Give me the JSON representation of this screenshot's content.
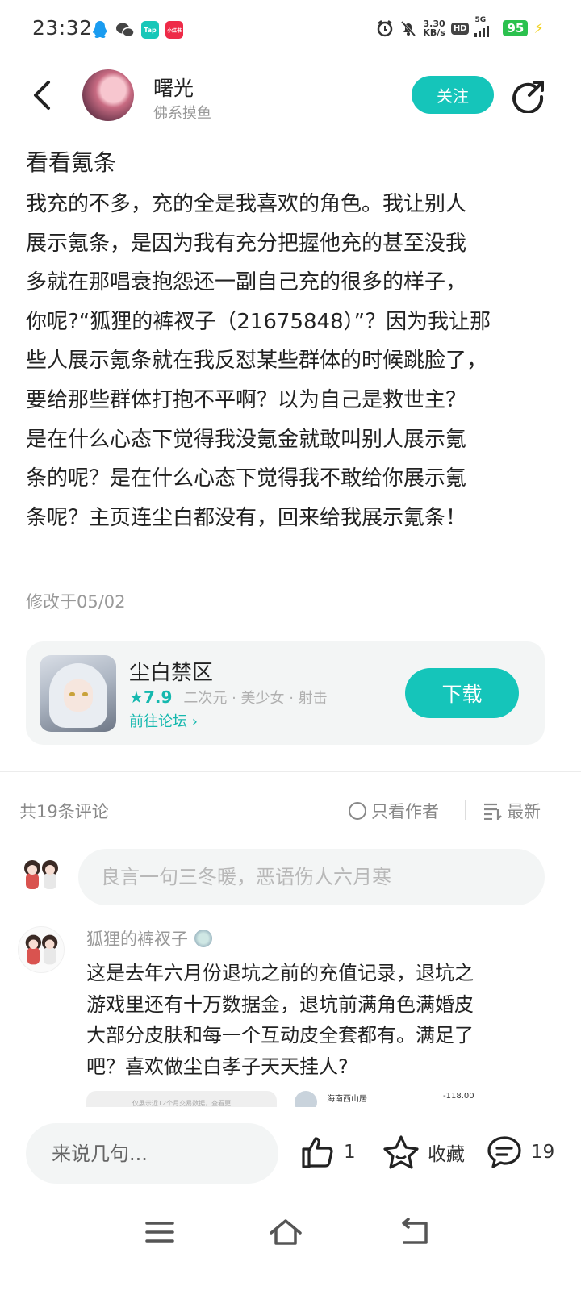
{
  "status_bar": {
    "time": "23:32",
    "taptap_label": "Tap",
    "xhs_label": "小红书",
    "net_speed_value": "3.30",
    "net_speed_unit": "KB/s",
    "hd_label": "HD",
    "network_label": "5G",
    "battery": "95"
  },
  "header": {
    "author_name": "曙光",
    "author_tag": "佛系摸鱼",
    "follow_label": "关注"
  },
  "post": {
    "title": "看看氪条",
    "content": "我充的不多，充的全是我喜欢的角色。我让别人\n展示氪条，是因为我有充分把握他充的甚至没我\n多就在那唱衰抱怨还一副自己充的很多的样子，\n你呢?“狐狸的裤衩子（21675848）”？因为我让那\n些人展示氪条就在我反怼某些群体的时候跳脸了，\n要给那些群体打抱不平啊？以为自己是救世主？\n是在什么心态下觉得我没氪金就敢叫别人展示氪\n条的呢？是在什么心态下觉得我不敢给你展示氪\n条呢？主页连尘白都没有，回来给我展示氪条！",
    "modified": "修改于05/02"
  },
  "game_card": {
    "name": "尘白禁区",
    "score": "7.9",
    "tags": "二次元 · 美少女 · 射击",
    "forum_link": "前往论坛",
    "download_label": "下载"
  },
  "comments_header": {
    "count": "共19条评论",
    "only_author": "只看作者",
    "sort": "最新"
  },
  "comment_input": {
    "placeholder": "良言一句三冬暖，恶语伤人六月寒"
  },
  "comments": [
    {
      "author": "狐狸的裤衩子",
      "text": "这是去年六月份退坑之前的充值记录，退坑之\n游戏里还有十万数据金，退坑前满角色满婚皮\n大部分皮肤和每一个互动皮全套都有。满足了\n吧？喜欢做尘白孝子天天挂人?",
      "img_caption": "仅展示近12个月交易数据，查看更",
      "img_merchant": "海南西山居",
      "img_amount": "-118.00"
    }
  ],
  "bottom_bar": {
    "reply_placeholder": "来说几句...",
    "like_count": "1",
    "favorite_label": "收藏",
    "comment_count": "19"
  },
  "colors": {
    "accent": "#15c5ba",
    "background": "#ffffff",
    "card_bg": "#f3f5f5"
  },
  "icons": [
    "back-icon",
    "share-icon",
    "star-icon",
    "chevron-right-icon",
    "radio-icon",
    "sort-icon",
    "like-icon",
    "favorite-icon",
    "comment-icon",
    "menu-icon",
    "home-icon",
    "return-icon"
  ]
}
